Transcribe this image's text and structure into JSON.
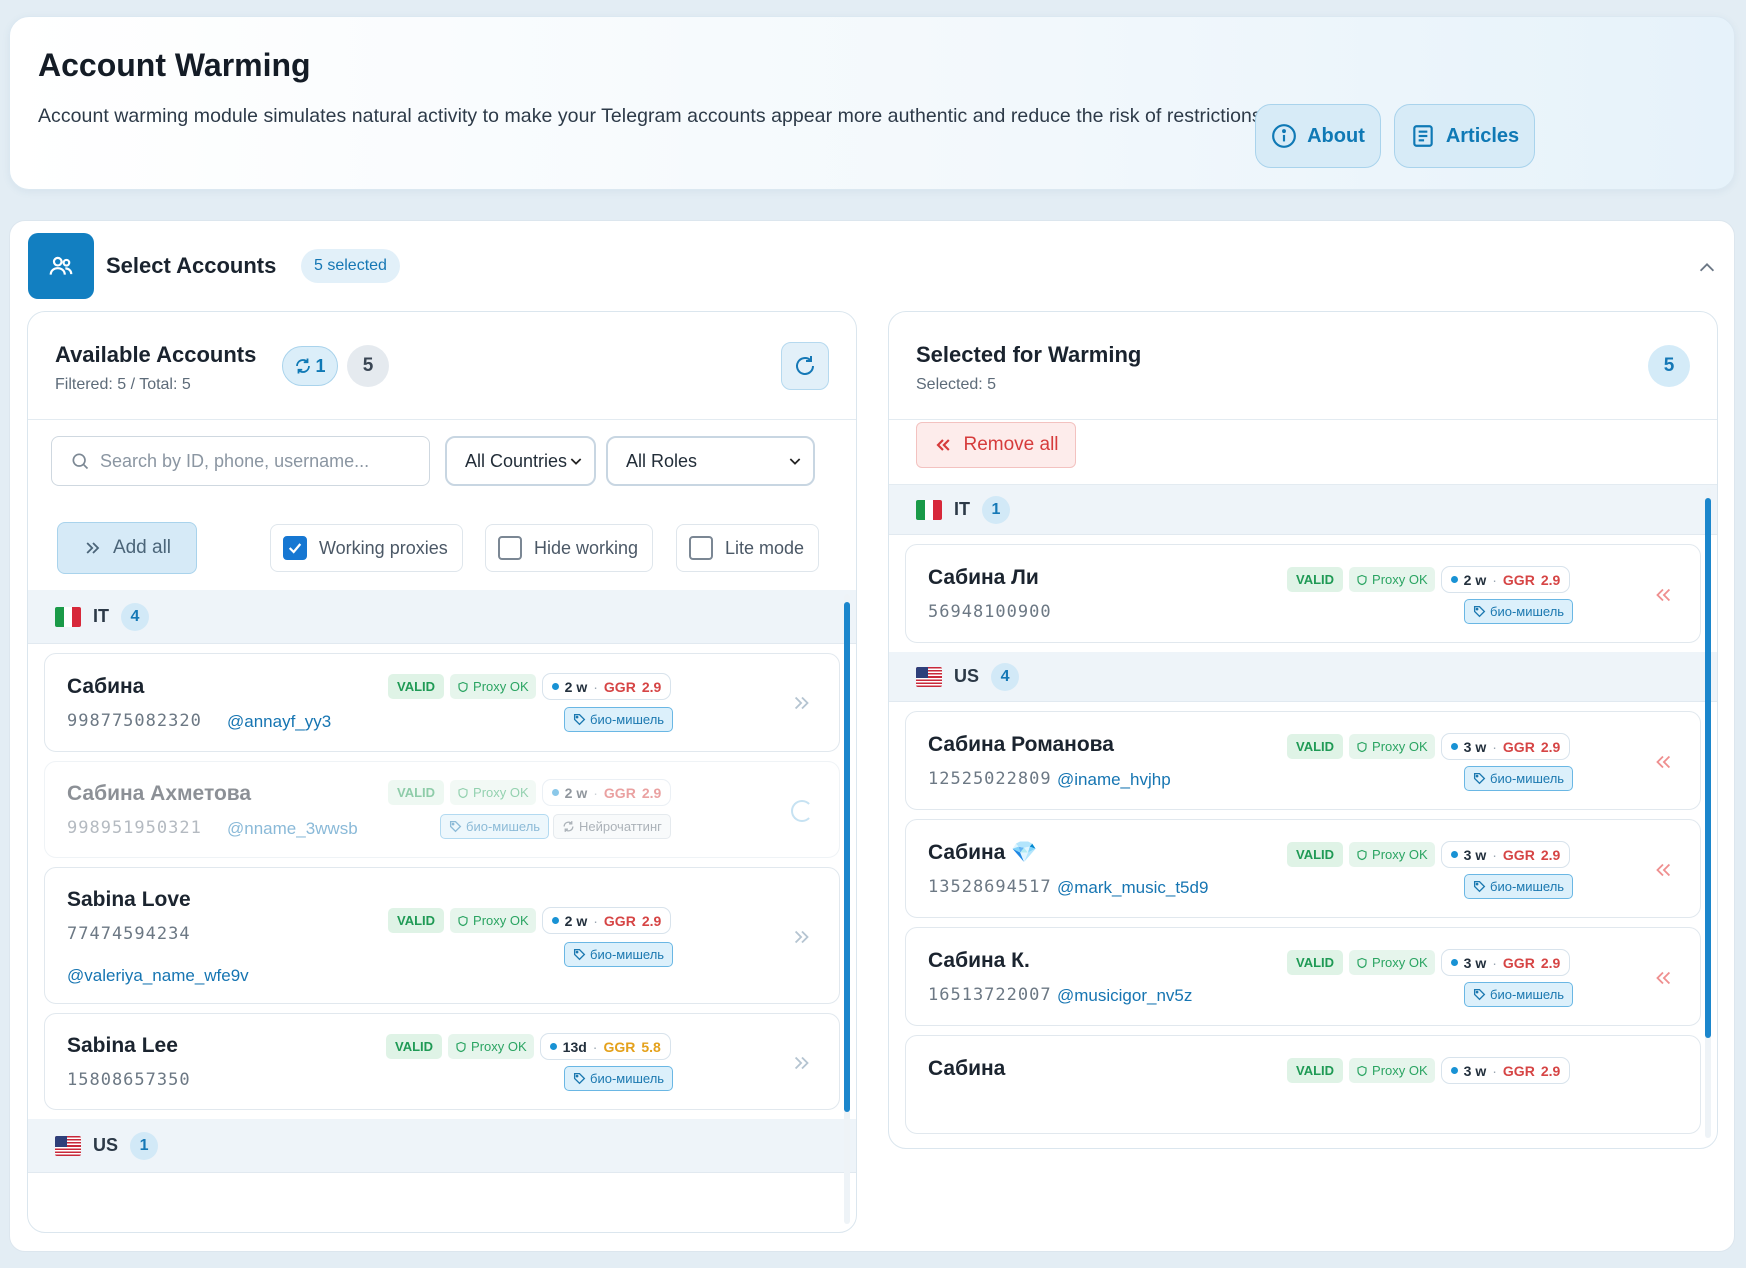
{
  "header": {
    "title": "Account Warming",
    "description": "Account warming module simulates natural activity to make your Telegram accounts appear more authentic and reduce the risk of restrictions.",
    "about_label": "About",
    "articles_label": "Articles"
  },
  "select": {
    "title": "Select Accounts",
    "selected_badge": "5 selected"
  },
  "available": {
    "title": "Available Accounts",
    "subtitle": "Filtered: 5 / Total: 5",
    "sync_count": "1",
    "count": "5",
    "search_placeholder": "Search by ID, phone, username...",
    "country_filter": "All Countries",
    "role_filter": "All Roles",
    "add_all_label": "Add all",
    "filters": [
      {
        "label": "Working proxies",
        "checked": true
      },
      {
        "label": "Hide working",
        "checked": false
      },
      {
        "label": "Lite mode",
        "checked": false
      }
    ],
    "groups": [
      {
        "code": "IT",
        "count": "4"
      },
      {
        "code": "US",
        "count": "1"
      }
    ],
    "accounts": [
      {
        "name": "Сабина",
        "phone": "998775082320",
        "username": "@annayf_yy3",
        "status": "VALID",
        "proxy": "Proxy OK",
        "age": "2 w",
        "ggr_label": "GGR",
        "ggr": "2.9",
        "tags": [
          "био-мишель"
        ]
      },
      {
        "name": "Сабина Ахметова",
        "phone": "998951950321",
        "username": "@nname_3wwsb",
        "status": "VALID",
        "proxy": "Proxy OK",
        "age": "2 w",
        "ggr_label": "GGR",
        "ggr": "2.9",
        "tags": [
          "био-мишель",
          "Нейрочаттинг"
        ]
      },
      {
        "name": "Sabina Love",
        "phone": "77474594234",
        "username": "@valeriya_name_wfe9v",
        "status": "VALID",
        "proxy": "Proxy OK",
        "age": "2 w",
        "ggr_label": "GGR",
        "ggr": "2.9",
        "tags": [
          "био-мишель"
        ]
      },
      {
        "name": "Sabina Lee",
        "phone": "15808657350",
        "username": "",
        "status": "VALID",
        "proxy": "Proxy OK",
        "age": "13d",
        "ggr_label": "GGR",
        "ggr": "5.8",
        "tags": [
          "био-мишель"
        ]
      }
    ]
  },
  "selected": {
    "title": "Selected for Warming",
    "subtitle": "Selected: 5",
    "count": "5",
    "remove_all_label": "Remove all",
    "groups": [
      {
        "code": "IT",
        "count": "1"
      },
      {
        "code": "US",
        "count": "4"
      }
    ],
    "accounts": [
      {
        "name": "Сабина Ли",
        "phone": "56948100900",
        "username": "",
        "status": "VALID",
        "proxy": "Proxy OK",
        "age": "2 w",
        "ggr_label": "GGR",
        "ggr": "2.9",
        "tags": [
          "био-мишель"
        ]
      },
      {
        "name": "Сабина Романова",
        "phone": "12525022809",
        "username": "@iname_hvjhp",
        "status": "VALID",
        "proxy": "Proxy OK",
        "age": "3 w",
        "ggr_label": "GGR",
        "ggr": "2.9",
        "tags": [
          "био-мишель"
        ]
      },
      {
        "name": "Сабина",
        "emoji": "💎",
        "phone": "13528694517",
        "username": "@mark_music_t5d9",
        "status": "VALID",
        "proxy": "Proxy OK",
        "age": "3 w",
        "ggr_label": "GGR",
        "ggr": "2.9",
        "tags": [
          "био-мишель"
        ]
      },
      {
        "name": "Сабина К.",
        "phone": "16513722007",
        "username": "@musicigor_nv5z",
        "status": "VALID",
        "proxy": "Proxy OK",
        "age": "3 w",
        "ggr_label": "GGR",
        "ggr": "2.9",
        "tags": [
          "био-мишель"
        ]
      },
      {
        "name": "Сабина",
        "phone": "",
        "username": "",
        "status": "VALID",
        "proxy": "Proxy OK",
        "age": "3 w",
        "ggr_label": "GGR",
        "ggr": "2.9",
        "tags": []
      }
    ]
  },
  "colors": {
    "accent": "#127fc1",
    "valid": "#1f9a55",
    "ggr_red": "#d64545",
    "ggr_amber": "#e4a11b",
    "remove": "#d63b3b"
  },
  "icons": {
    "about": "info-circle-icon",
    "articles": "document-icon",
    "select": "users-icon",
    "collapse": "chevron-up-icon",
    "sync": "sync-icon",
    "refresh": "refresh-icon",
    "search": "search-icon",
    "add_all": "double-chevron-right-icon",
    "remove": "double-chevron-left-icon",
    "proxy": "shield-icon",
    "tag": "tag-icon"
  }
}
